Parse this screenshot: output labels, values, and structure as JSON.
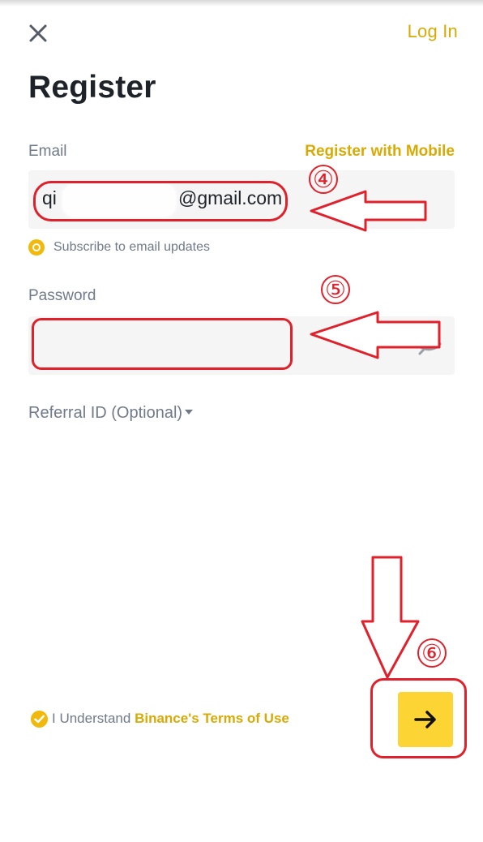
{
  "header": {
    "close_icon": "close-icon",
    "login_label": "Log In"
  },
  "page": {
    "title": "Register"
  },
  "email": {
    "label": "Email",
    "alternate_label": "Register with Mobile",
    "value_prefix": "qi",
    "value_domain": "@gmail.com"
  },
  "subscription": {
    "label": "Subscribe to email updates"
  },
  "password": {
    "label": "Password",
    "visibility_icon": "eye-off-icon"
  },
  "referral": {
    "label": "Referral ID (Optional)"
  },
  "terms": {
    "prefix": "I Understand ",
    "link": "Binance's Terms of Use"
  },
  "submit": {
    "icon": "arrow-right-icon"
  },
  "annotations": {
    "step_4": "④",
    "step_5": "⑤",
    "step_6": "⑥"
  },
  "colors": {
    "brand": "#F0B90B",
    "link": "#D8AA05",
    "annotation": "#E0212B",
    "input_background": "#F5F5F5"
  }
}
